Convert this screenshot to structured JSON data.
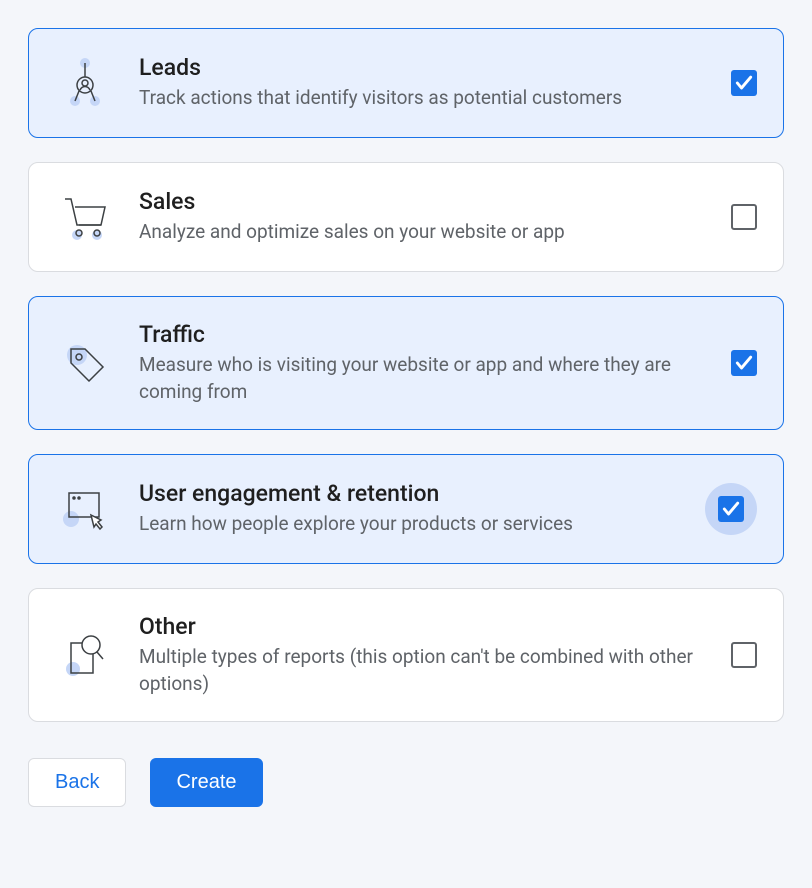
{
  "options": [
    {
      "id": "leads",
      "title": "Leads",
      "description": "Track actions that identify visitors as potential customers",
      "checked": true,
      "icon": "leads-icon"
    },
    {
      "id": "sales",
      "title": "Sales",
      "description": "Analyze and optimize sales on your website or app",
      "checked": false,
      "icon": "cart-icon"
    },
    {
      "id": "traffic",
      "title": "Traffic",
      "description": "Measure who is visiting your website or app and where they are coming from",
      "checked": true,
      "icon": "tag-icon"
    },
    {
      "id": "engagement",
      "title": "User engagement & retention",
      "description": "Learn how people explore your products or services",
      "checked": true,
      "halo": true,
      "icon": "window-cursor-icon"
    },
    {
      "id": "other",
      "title": "Other",
      "description": "Multiple types of reports (this option can't be combined with other options)",
      "checked": false,
      "icon": "search-page-icon"
    }
  ],
  "footer": {
    "back_label": "Back",
    "create_label": "Create"
  }
}
